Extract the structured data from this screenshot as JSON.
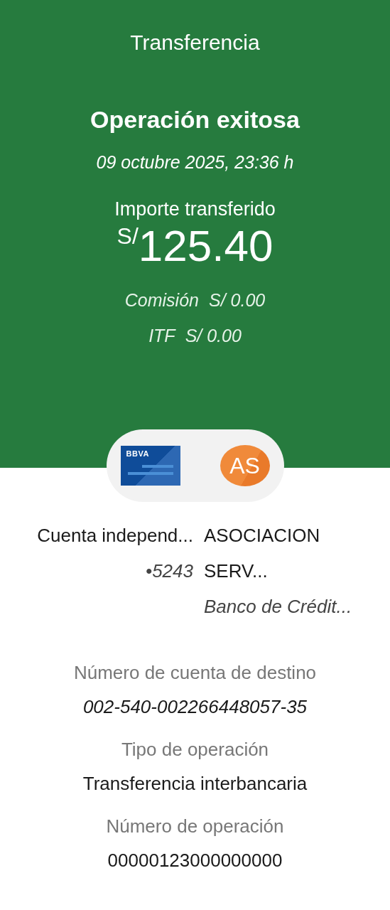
{
  "header": {
    "title": "Transferencia",
    "status": "Operación exitosa",
    "datetime": "09 octubre 2025, 23:36 h",
    "amount_label": "Importe transferido",
    "currency": "S/",
    "amount": "125.40",
    "fees": [
      {
        "label": "Comisión",
        "value": "S/ 0.00"
      },
      {
        "label": "ITF",
        "value": "S/ 0.00"
      }
    ]
  },
  "parties": {
    "origin": {
      "logo": "BBVA",
      "name": "Cuenta independ...",
      "account": "•5243"
    },
    "destination": {
      "initials": "AS",
      "name_lines": [
        "ASOCIACION",
        "SERV..."
      ],
      "bank": "Banco de Crédit..."
    }
  },
  "details": [
    {
      "label": "Número de cuenta de destino",
      "value": "002-540-002266448057-35",
      "italic": true
    },
    {
      "label": "Tipo de operación",
      "value": "Transferencia interbancaria",
      "italic": false
    },
    {
      "label": "Número de operación",
      "value": "00000123000000000",
      "italic": false
    }
  ]
}
